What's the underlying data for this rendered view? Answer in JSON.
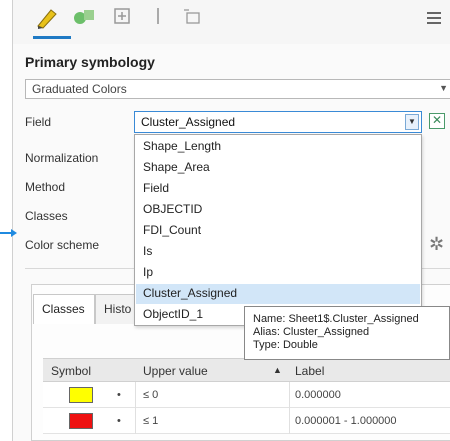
{
  "panel": {
    "section_title": "Primary symbology",
    "method_value": "Graduated Colors"
  },
  "fields": {
    "field_label": "Field",
    "field_value": "Cluster_Assigned",
    "normalization_label": "Normalization",
    "method_label": "Method",
    "classes_label": "Classes",
    "color_scheme_label": "Color scheme"
  },
  "dropdown": {
    "items": [
      {
        "label": "Shape_Length"
      },
      {
        "label": "Shape_Area"
      },
      {
        "label": "Field"
      },
      {
        "label": "OBJECTID"
      },
      {
        "label": "FDI_Count"
      },
      {
        "label": "Is"
      },
      {
        "label": "Ip"
      },
      {
        "label": "Cluster_Assigned"
      },
      {
        "label": "ObjectID_1"
      }
    ],
    "selected_index": 7
  },
  "tooltip": {
    "name_line": "Name: Sheet1$.Cluster_Assigned",
    "alias_line": "Alias: Cluster_Assigned",
    "type_line": "Type: Double"
  },
  "subtabs": {
    "classes": "Classes",
    "histogram": "Histo"
  },
  "grid": {
    "headers": {
      "symbol": "Symbol",
      "upper": "Upper value",
      "label": "Label"
    },
    "rows": [
      {
        "upper": "≤  0",
        "label": "0.000000",
        "color": "#ffff00"
      },
      {
        "upper": "≤  1",
        "label": "0.000001 - 1.000000",
        "color": "#ee1111"
      }
    ]
  },
  "colors": {
    "accent": "#1f7ac4",
    "selection": "#d2e6f8"
  }
}
